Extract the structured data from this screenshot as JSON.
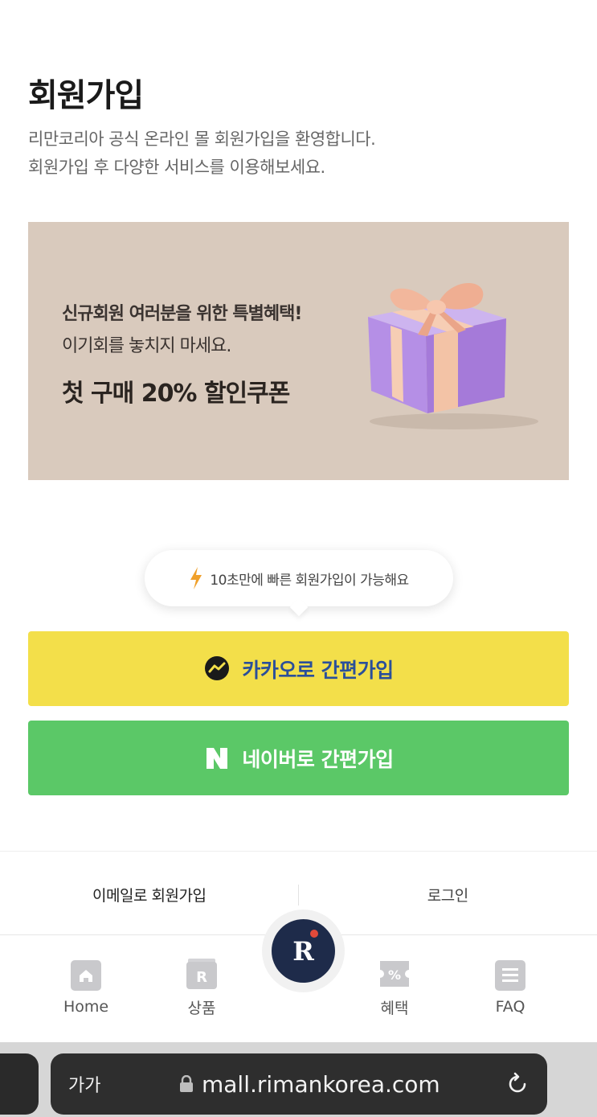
{
  "header": {
    "title": "회원가입",
    "subtitle_lines": [
      "리만코리아 공식 온라인 몰 회원가입을 환영합니다.",
      "회원가입 후 다양한 서비스를 이용해보세요."
    ]
  },
  "banner": {
    "line1": "신규회원 여러분을 위한 특별혜택!",
    "line2": "이기회를 놓치지 마세요.",
    "line3": "첫 구매 20% 할인쿠폰",
    "icon": "gift-box-illustration"
  },
  "tooltip": {
    "text": "10초만에 빠른 회원가입이 가능해요",
    "icon": "lightning-icon"
  },
  "buttons": {
    "kakao_label": "카카오로 간편가입",
    "naver_label": "네이버로 간편가입"
  },
  "links": {
    "email_signup": "이메일로 회원가입",
    "login": "로그인"
  },
  "bottom_nav": {
    "items": [
      {
        "label": "Home",
        "icon": "home-icon"
      },
      {
        "label": "상품",
        "icon": "product-icon"
      },
      {
        "label": "혜택",
        "icon": "coupon-icon"
      },
      {
        "label": "FAQ",
        "icon": "faq-icon"
      }
    ],
    "fab_letter": "R"
  },
  "browser": {
    "text_size_label": "가가",
    "url": "mall.rimankorea.com"
  },
  "colors": {
    "kakao_bg": "#f3df4a",
    "kakao_text": "#2a4f9a",
    "naver_bg": "#5bc867",
    "banner_bg": "#d9cabd",
    "fab_bg": "#1e2b4a",
    "fab_dot": "#e24a3a"
  }
}
